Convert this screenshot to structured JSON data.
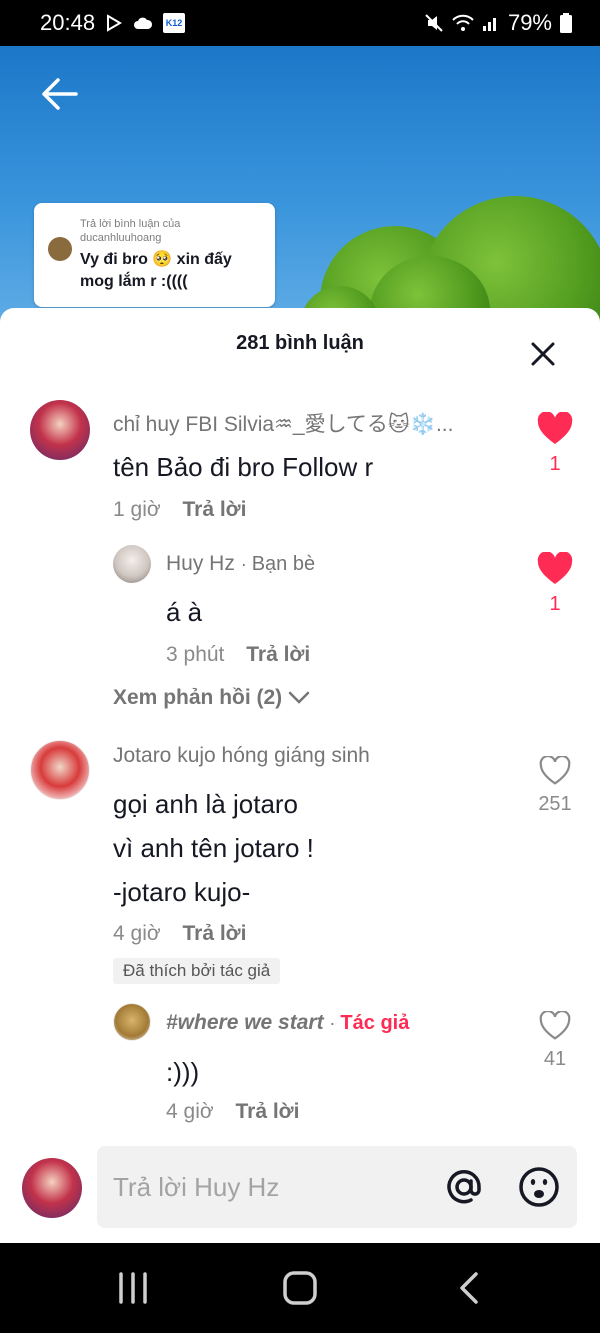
{
  "status_bar": {
    "time": "20:48",
    "battery": "79%"
  },
  "video": {
    "reply_card": {
      "label": "Trả lời bình luận của ducanhluuhoang",
      "text": "Vy đi bro 🥺 xin đấy mog lắm r :(((("
    }
  },
  "comments_sheet": {
    "count_label": "281 bình luận",
    "comments": [
      {
        "username": "chỉ huy FBI Silvia♒_愛してる🐱❄️...",
        "text": "tên Bảo đi bro Follow r",
        "time": "1 giờ",
        "reply_label": "Trả lời",
        "likes": "1",
        "liked": true
      },
      {
        "username": "Huy Hz",
        "relation": "Bạn bè",
        "text": "á à",
        "time": "3 phút",
        "reply_label": "Trả lời",
        "likes": "1",
        "liked": true
      },
      {
        "username": "Jotaro kujo hóng giáng sinh",
        "text_lines": [
          "gọi anh là jotaro",
          "vì anh tên jotaro !",
          "-jotaro kujo-"
        ],
        "time": "4 giờ",
        "reply_label": "Trả lời",
        "likes": "251",
        "liked": false,
        "badge": "Đã thích bởi tác giả"
      },
      {
        "username": "#where we start",
        "relation": "Tác giả",
        "text": ":)))",
        "time": "4 giờ",
        "reply_label": "Trả lời",
        "likes": "41",
        "liked": false
      }
    ],
    "view_replies": "Xem phản hồi (2)"
  },
  "input": {
    "placeholder": "Trả lời Huy Hz"
  },
  "colors": {
    "accent": "#fe2c55",
    "text": "#161823",
    "muted": "#8a8a8a"
  }
}
